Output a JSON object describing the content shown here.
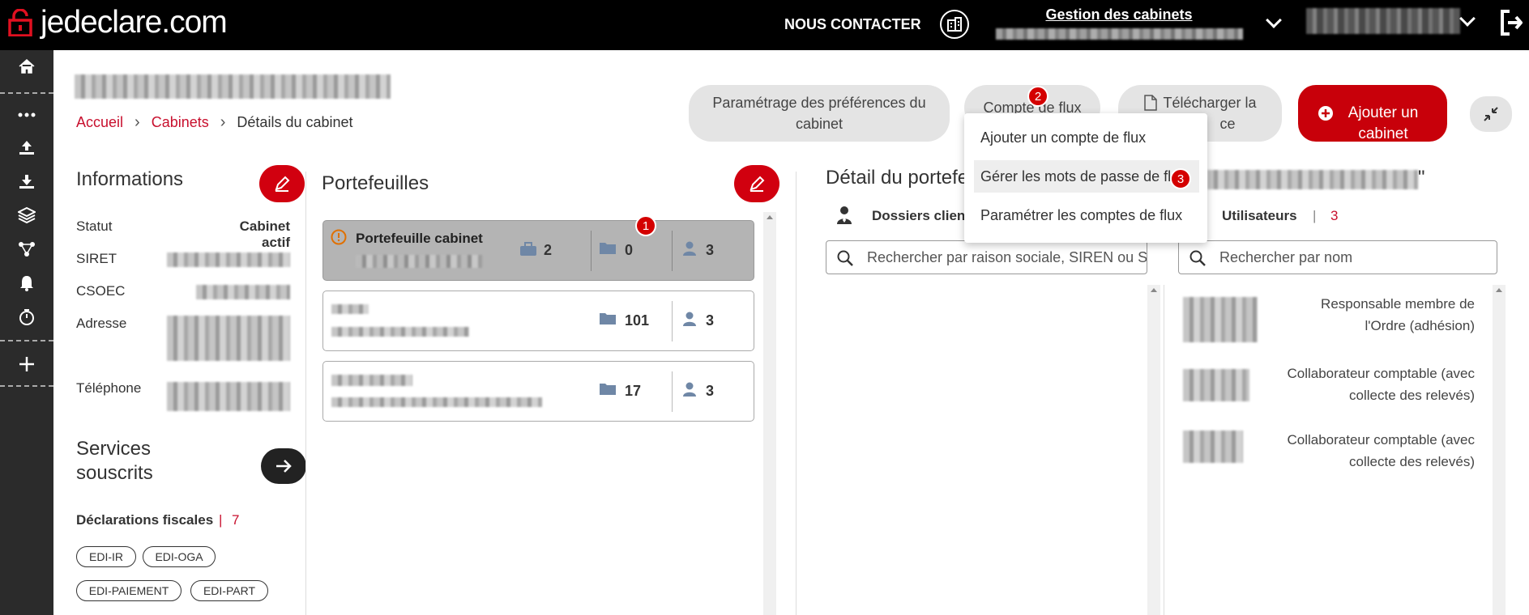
{
  "header": {
    "logo_text": "jedeclare.com",
    "contact_label": "NOUS CONTACTER",
    "gestion_title": "Gestion des cabinets"
  },
  "sidebar": {
    "items": [
      "home-icon",
      "more-icon",
      "upload-icon",
      "download-icon",
      "layers-icon",
      "network-icon",
      "bell-icon",
      "timer-icon",
      "plus-icon"
    ]
  },
  "breadcrumb": {
    "home": "Accueil",
    "cabinets": "Cabinets",
    "current": "Détails du cabinet"
  },
  "actions": {
    "preferences": "Paramétrage des préférences du cabinet",
    "compte_flux": "Compte de flux",
    "telecharger": "Télécharger la",
    "telecharger_tail": "ce",
    "ajouter_cabinet": "Ajouter un cabinet"
  },
  "dropdown": {
    "items": [
      "Ajouter un compte de flux",
      "Gérer les mots de passe de flux",
      "Paramétrer les comptes de flux"
    ]
  },
  "badges": {
    "one": "1",
    "two": "2",
    "three": "3"
  },
  "informations": {
    "title": "Informations",
    "statut_label": "Statut",
    "statut_value": "Cabinet actif",
    "siret_label": "SIRET",
    "csoec_label": "CSOEC",
    "adresse_label": "Adresse",
    "telephone_label": "Téléphone"
  },
  "services": {
    "title": "Services souscrits",
    "declarations_label": "Déclarations fiscales",
    "declarations_count": "7",
    "tags": [
      "EDI-IR",
      "EDI-OGA",
      "EDI-PAIEMENT",
      "EDI-PART"
    ]
  },
  "portefeuilles": {
    "title": "Portefeuilles",
    "cards": [
      {
        "name": "Portefeuille cabinet",
        "briefcase": "2",
        "folders": "0",
        "users": "3"
      },
      {
        "folders": "101",
        "users": "3"
      },
      {
        "folders": "17",
        "users": "3"
      }
    ]
  },
  "detail": {
    "title": "Détail du portefe",
    "quote": "\"",
    "dossiers_tab": "Dossiers client",
    "utilisateurs_tab": "Utilisateurs",
    "utilisateurs_sep": "|",
    "utilisateurs_count": "3",
    "search_dossiers_placeholder": "Rechercher par raison sociale, SIREN ou S",
    "search_users_placeholder": "Rechercher par nom",
    "users": [
      {
        "role_line1": "Responsable membre de",
        "role_line2": "l'Ordre (adhésion)"
      },
      {
        "role_line1": "Collaborateur comptable (avec",
        "role_line2": "collecte des relevés)"
      },
      {
        "role_line1": "Collaborateur comptable (avec",
        "role_line2": "collecte des relevés)"
      }
    ]
  },
  "colors": {
    "accent": "#c8102e",
    "topbar": "#000000",
    "sidebar": "#2b2b2b"
  }
}
